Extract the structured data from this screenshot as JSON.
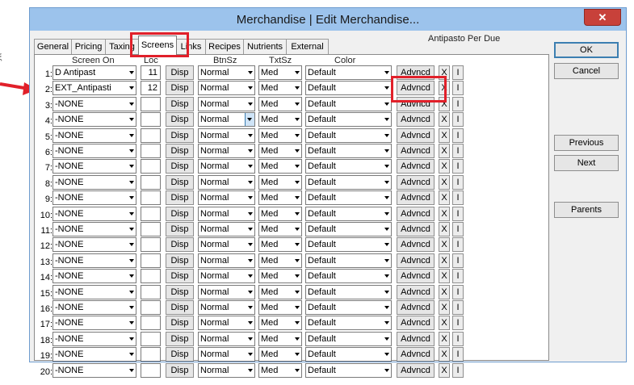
{
  "window": {
    "title": "Merchandise | Edit Merchandise...",
    "close_label": "✕",
    "item_name": "Antipasto Per Due"
  },
  "tabs": [
    "General",
    "Pricing",
    "Taxing",
    "Screens",
    "Links",
    "Recipes",
    "Nutrients",
    "External"
  ],
  "active_tab": "Screens",
  "headers": {
    "screen_on": "Screen On",
    "loc": "Loc",
    "btnsz": "BtnSz",
    "txtsz": "TxtSz",
    "color": "Color"
  },
  "row_buttons": {
    "disp": "Disp",
    "advncd": "Advncd",
    "x": "X",
    "i": "I"
  },
  "rows": [
    {
      "num": "1:",
      "screen": "D Antipast",
      "loc": "11",
      "btnsz": "Normal",
      "txtsz": "Med",
      "color": "Default"
    },
    {
      "num": "2:",
      "screen": "EXT_Antipasti",
      "loc": "12",
      "btnsz": "Normal",
      "txtsz": "Med",
      "color": "Default"
    },
    {
      "num": "3:",
      "screen": "-NONE",
      "loc": "",
      "btnsz": "Normal",
      "txtsz": "Med",
      "color": "Default"
    },
    {
      "num": "4:",
      "screen": "-NONE",
      "loc": "",
      "btnsz": "Normal",
      "txtsz": "Med",
      "color": "Default"
    },
    {
      "num": "5:",
      "screen": "-NONE",
      "loc": "",
      "btnsz": "Normal",
      "txtsz": "Med",
      "color": "Default"
    },
    {
      "num": "6:",
      "screen": "-NONE",
      "loc": "",
      "btnsz": "Normal",
      "txtsz": "Med",
      "color": "Default"
    },
    {
      "num": "7:",
      "screen": "-NONE",
      "loc": "",
      "btnsz": "Normal",
      "txtsz": "Med",
      "color": "Default"
    },
    {
      "num": "8:",
      "screen": "-NONE",
      "loc": "",
      "btnsz": "Normal",
      "txtsz": "Med",
      "color": "Default"
    },
    {
      "num": "9:",
      "screen": "-NONE",
      "loc": "",
      "btnsz": "Normal",
      "txtsz": "Med",
      "color": "Default"
    },
    {
      "num": "10:",
      "screen": "-NONE",
      "loc": "",
      "btnsz": "Normal",
      "txtsz": "Med",
      "color": "Default"
    },
    {
      "num": "11:",
      "screen": "-NONE",
      "loc": "",
      "btnsz": "Normal",
      "txtsz": "Med",
      "color": "Default"
    },
    {
      "num": "12:",
      "screen": "-NONE",
      "loc": "",
      "btnsz": "Normal",
      "txtsz": "Med",
      "color": "Default"
    },
    {
      "num": "13:",
      "screen": "-NONE",
      "loc": "",
      "btnsz": "Normal",
      "txtsz": "Med",
      "color": "Default"
    },
    {
      "num": "14:",
      "screen": "-NONE",
      "loc": "",
      "btnsz": "Normal",
      "txtsz": "Med",
      "color": "Default"
    },
    {
      "num": "15:",
      "screen": "-NONE",
      "loc": "",
      "btnsz": "Normal",
      "txtsz": "Med",
      "color": "Default"
    },
    {
      "num": "16:",
      "screen": "-NONE",
      "loc": "",
      "btnsz": "Normal",
      "txtsz": "Med",
      "color": "Default"
    },
    {
      "num": "17:",
      "screen": "-NONE",
      "loc": "",
      "btnsz": "Normal",
      "txtsz": "Med",
      "color": "Default"
    },
    {
      "num": "18:",
      "screen": "-NONE",
      "loc": "",
      "btnsz": "Normal",
      "txtsz": "Med",
      "color": "Default"
    },
    {
      "num": "19:",
      "screen": "-NONE",
      "loc": "",
      "btnsz": "Normal",
      "txtsz": "Med",
      "color": "Default"
    },
    {
      "num": "20:",
      "screen": "-NONE",
      "loc": "",
      "btnsz": "Normal",
      "txtsz": "Med",
      "color": "Default"
    }
  ],
  "side_buttons": {
    "ok": "OK",
    "cancel": "Cancel",
    "previous": "Previous",
    "next": "Next",
    "parents": "Parents"
  },
  "colors": {
    "titlebar": "#9cc3ec",
    "annotation": "#e1202a",
    "close_button": "#c8413a"
  }
}
